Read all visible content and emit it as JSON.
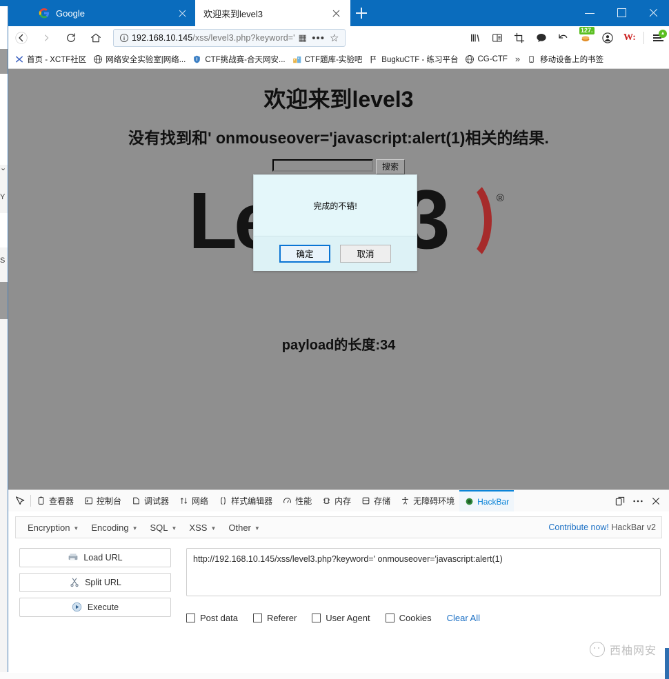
{
  "desktop": {
    "top_partial_text": "西柚网安",
    "left_glyphs": [
      "⌄",
      "Y",
      "S"
    ]
  },
  "browser": {
    "tabs": [
      {
        "title": "Google",
        "favicon": "google-icon",
        "active": false
      },
      {
        "title": "欢迎来到level3",
        "favicon": "page-icon",
        "active": true
      }
    ],
    "new_tab_label": "+",
    "window_controls": {
      "minimize": "minimize-icon",
      "maximize": "maximize-icon",
      "close": "close-icon"
    },
    "nav": {
      "back": "back-arrow-icon",
      "forward": "forward-arrow-icon",
      "reload": "reload-icon",
      "home": "home-icon",
      "url_host": "192.168.10.145",
      "url_path": "/xss/level3.php?keyword='",
      "identity_icon": "info-circle-icon",
      "qr_icon": "qr-code-icon",
      "page_actions_icon": "ellipsis-icon",
      "bookmark_star_icon": "star-icon"
    },
    "toolbar_icons": [
      {
        "name": "library-icon",
        "label": ""
      },
      {
        "name": "reader-view-icon",
        "label": ""
      },
      {
        "name": "screenshot-icon",
        "label": ""
      },
      {
        "name": "chat-bubble-icon",
        "label": ""
      },
      {
        "name": "undo-arrow-icon",
        "label": ""
      },
      {
        "name": "extension-badge-icon",
        "label": "127."
      },
      {
        "name": "account-circle-icon",
        "label": ""
      },
      {
        "name": "wappalyzer-icon",
        "label": "W:"
      }
    ],
    "menu_icon": "hamburger-menu-icon",
    "bookmarks": [
      {
        "label": "首页 - XCTF社区",
        "icon": "xctf-icon"
      },
      {
        "label": "网络安全实验室|网络...",
        "icon": "globe-icon"
      },
      {
        "label": "CTF挑战赛-合天网安...",
        "icon": "shield-icon"
      },
      {
        "label": "CTF题库-实验吧",
        "icon": "lab-icon"
      },
      {
        "label": "BugkuCTF - 练习平台",
        "icon": "flag-icon"
      },
      {
        "label": "CG-CTF",
        "icon": "globe-icon"
      }
    ],
    "bookmarks_overflow": "»",
    "bookmarks_mobile": {
      "label": "移动设备上的书签",
      "icon": "mobile-icon"
    }
  },
  "page": {
    "heading": "欢迎来到level3",
    "subheading": "没有找到和' onmouseover='javascript:alert(1)相关的结果.",
    "search_value": "",
    "search_placeholder": "",
    "search_button": "搜索",
    "logo_word": "Level",
    "logo_paren_number": "3",
    "logo_registered": "®",
    "payload_text": "payload的长度:34"
  },
  "dialog": {
    "message": "完成的不错!",
    "confirm_label": "确定",
    "cancel_label": "取消"
  },
  "devtools": {
    "picker_icon": "element-picker-icon",
    "tabs": [
      {
        "label": "查看器",
        "icon": "inspector-icon",
        "active": false
      },
      {
        "label": "控制台",
        "icon": "console-icon",
        "active": false
      },
      {
        "label": "调试器",
        "icon": "debugger-icon",
        "active": false
      },
      {
        "label": "网络",
        "icon": "network-icon",
        "active": false
      },
      {
        "label": "样式编辑器",
        "icon": "style-editor-icon",
        "active": false
      },
      {
        "label": "性能",
        "icon": "performance-icon",
        "active": false
      },
      {
        "label": "内存",
        "icon": "memory-icon",
        "active": false
      },
      {
        "label": "存储",
        "icon": "storage-icon",
        "active": false
      },
      {
        "label": "无障碍环境",
        "icon": "accessibility-icon",
        "active": false
      },
      {
        "label": "HackBar",
        "icon": "hackbar-icon",
        "active": true
      }
    ],
    "right_buttons": [
      {
        "name": "dock-layout-icon"
      },
      {
        "name": "ellipsis-icon"
      },
      {
        "name": "close-icon"
      }
    ],
    "active_tab_color": "#0a84d8"
  },
  "hackbar": {
    "menus": [
      {
        "label": "Encryption"
      },
      {
        "label": "Encoding"
      },
      {
        "label": "SQL"
      },
      {
        "label": "XSS"
      },
      {
        "label": "Other"
      }
    ],
    "contribute_link": "Contribute now!",
    "version_text": " HackBar v2",
    "buttons": [
      {
        "label": "Load URL",
        "icon": "load-url-icon"
      },
      {
        "label": "Split URL",
        "icon": "scissors-icon"
      },
      {
        "label": "Execute",
        "icon": "play-icon"
      }
    ],
    "url_value": "http://192.168.10.145/xss/level3.php?keyword=' onmouseover='javascript:alert(1)",
    "checkboxes": [
      {
        "label": "Post data",
        "checked": false
      },
      {
        "label": "Referer",
        "checked": false
      },
      {
        "label": "User Agent",
        "checked": false
      },
      {
        "label": "Cookies",
        "checked": false
      }
    ],
    "clear_all_label": "Clear All"
  },
  "watermark": {
    "text": "西柚网安",
    "icon": "mascot-icon"
  }
}
